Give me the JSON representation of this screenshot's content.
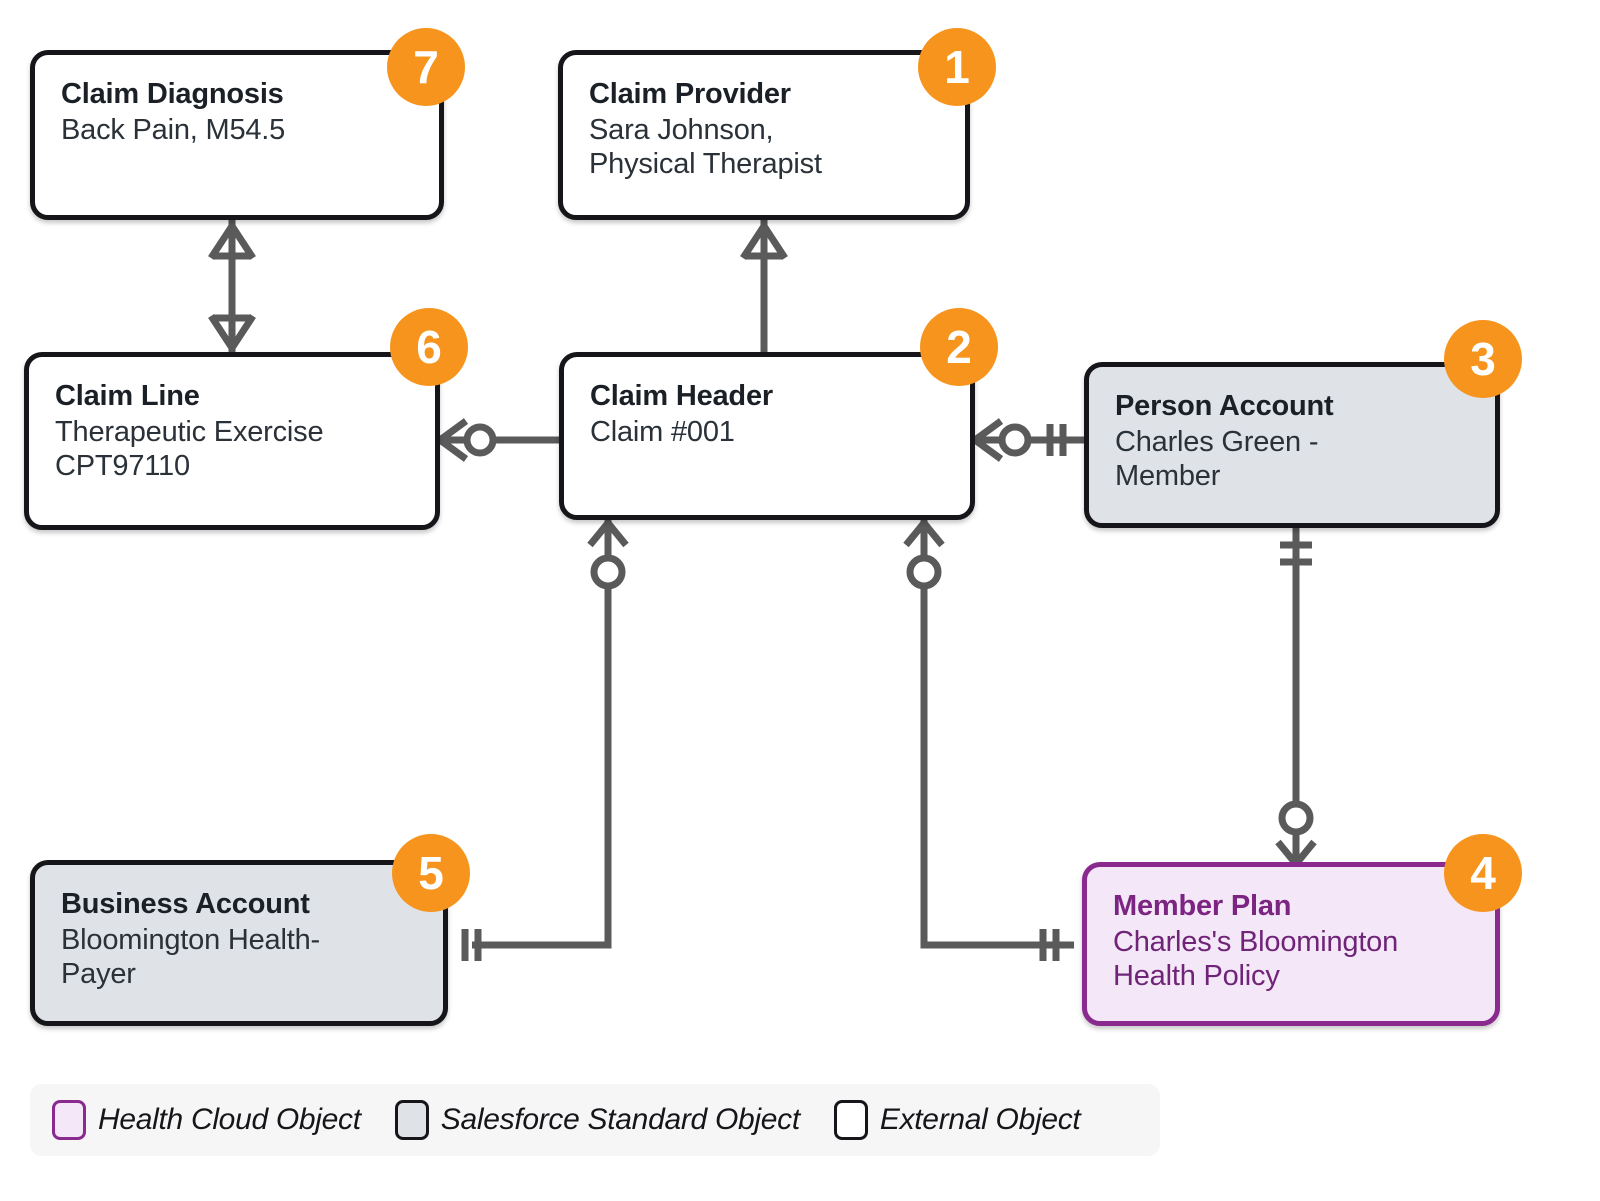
{
  "diagram": {
    "type": "entity-relationship",
    "colors": {
      "badge": "#f7941d",
      "external_border": "#16161a",
      "external_fill": "#ffffff",
      "standard_fill": "#dfe3e8",
      "healthcloud_border": "#8a2a8f",
      "healthcloud_fill": "#f4e7f7",
      "connector": "#5a5a5a",
      "legend_background": "#f6f6f7"
    },
    "nodes": [
      {
        "id": "claim-diagnosis",
        "badge": "7",
        "title": "Claim Diagnosis",
        "subtitle": "Back Pain, M54.5",
        "kind": "external"
      },
      {
        "id": "claim-provider",
        "badge": "1",
        "title": "Claim Provider",
        "subtitle": "Sara Johnson,\nPhysical Therapist",
        "kind": "external"
      },
      {
        "id": "claim-line",
        "badge": "6",
        "title": "Claim Line",
        "subtitle": "Therapeutic Exercise\nCPT97110",
        "kind": "external"
      },
      {
        "id": "claim-header",
        "badge": "2",
        "title": "Claim Header",
        "subtitle": "Claim #001",
        "kind": "external"
      },
      {
        "id": "person-account",
        "badge": "3",
        "title": "Person Account",
        "subtitle": "Charles Green -\nMember",
        "kind": "standard"
      },
      {
        "id": "business-account",
        "badge": "5",
        "title": "Business Account",
        "subtitle": "Bloomington Health-\nPayer",
        "kind": "standard"
      },
      {
        "id": "member-plan",
        "badge": "4",
        "title": "Member Plan",
        "subtitle": "Charles's Bloomington\nHealth Policy",
        "kind": "healthcloud"
      }
    ],
    "relationships": [
      {
        "from": "claim-diagnosis",
        "to": "claim-line",
        "from_notation": "one-or-many",
        "to_notation": "one-or-many"
      },
      {
        "from": "claim-provider",
        "to": "claim-header",
        "from_notation": "one-or-many",
        "to_notation": "plain"
      },
      {
        "from": "claim-line",
        "to": "claim-header",
        "from_notation": "zero-or-many",
        "to_notation": "plain"
      },
      {
        "from": "claim-header",
        "to": "person-account",
        "from_notation": "zero-or-many",
        "to_notation": "exactly-one"
      },
      {
        "from": "claim-header",
        "to": "business-account",
        "from_notation": "zero-or-many",
        "to_notation": "exactly-one"
      },
      {
        "from": "claim-header",
        "to": "member-plan",
        "from_notation": "zero-or-many",
        "to_notation": "exactly-one"
      },
      {
        "from": "person-account",
        "to": "member-plan",
        "from_notation": "exactly-one",
        "to_notation": "zero-or-many"
      }
    ]
  },
  "legend": {
    "items": [
      {
        "label": "Health Cloud Object",
        "kind": "healthcloud"
      },
      {
        "label": "Salesforce Standard Object",
        "kind": "standard"
      },
      {
        "label": "External Object",
        "kind": "external"
      }
    ]
  }
}
